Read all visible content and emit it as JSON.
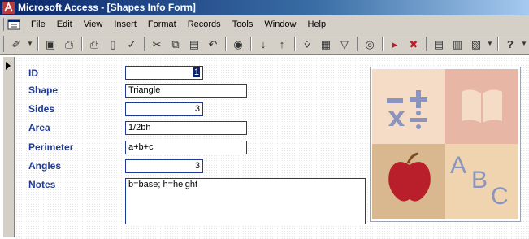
{
  "window": {
    "title": "Microsoft Access - [Shapes Info Form]"
  },
  "menu": [
    {
      "label": "File"
    },
    {
      "label": "Edit"
    },
    {
      "label": "View"
    },
    {
      "label": "Insert"
    },
    {
      "label": "Format"
    },
    {
      "label": "Records"
    },
    {
      "label": "Tools"
    },
    {
      "label": "Window"
    },
    {
      "label": "Help"
    }
  ],
  "toolbar": [
    {
      "icon": "design-view-icon",
      "glyph": "✐"
    },
    {
      "icon": "save-icon",
      "glyph": "▣"
    },
    {
      "icon": "print-preview-icon",
      "glyph": "⎙"
    },
    {
      "icon": "print-icon",
      "glyph": "⎙"
    },
    {
      "icon": "preview-icon",
      "glyph": "▯"
    },
    {
      "icon": "spelling-icon",
      "glyph": "✓"
    },
    {
      "icon": "cut-icon",
      "glyph": "✂"
    },
    {
      "icon": "copy-icon",
      "glyph": "⧉"
    },
    {
      "icon": "paste-icon",
      "glyph": "▤"
    },
    {
      "icon": "undo-icon",
      "glyph": "↶"
    },
    {
      "icon": "insert-hyperlink-icon",
      "glyph": "◉"
    },
    {
      "icon": "sort-ascending-icon",
      "glyph": "↓"
    },
    {
      "icon": "sort-descending-icon",
      "glyph": "↑"
    },
    {
      "icon": "filter-by-selection-icon",
      "glyph": "⩒"
    },
    {
      "icon": "filter-by-form-icon",
      "glyph": "▦"
    },
    {
      "icon": "apply-filter-icon",
      "glyph": "▽"
    },
    {
      "icon": "find-icon",
      "glyph": "◎"
    },
    {
      "icon": "new-record-icon",
      "glyph": "▸"
    },
    {
      "icon": "delete-record-icon",
      "glyph": "✖"
    },
    {
      "icon": "properties-icon",
      "glyph": "▤"
    },
    {
      "icon": "database-window-icon",
      "glyph": "▥"
    },
    {
      "icon": "new-object-icon",
      "glyph": "▧"
    },
    {
      "icon": "help-icon",
      "glyph": "?"
    }
  ],
  "form": {
    "fields": [
      {
        "name": "id",
        "label": "ID",
        "value": "1"
      },
      {
        "name": "shape",
        "label": "Shape",
        "value": "Triangle"
      },
      {
        "name": "sides",
        "label": "Sides",
        "value": "3"
      },
      {
        "name": "area",
        "label": "Area",
        "value": "1/2bh"
      },
      {
        "name": "perimeter",
        "label": "Perimeter",
        "value": "a+b+c"
      },
      {
        "name": "angles",
        "label": "Angles",
        "value": "3"
      },
      {
        "name": "notes",
        "label": "Notes",
        "value": "b=base; h=height"
      }
    ],
    "image": {
      "name": "school-subjects-image",
      "tiles": [
        {
          "icon": "math-symbols-icon",
          "color": "#f5dcc6"
        },
        {
          "icon": "book-icon",
          "color": "#e8b6a4"
        },
        {
          "icon": "apple-icon",
          "color": "#d9b890"
        },
        {
          "icon": "abc-letters-icon",
          "color": "#f0d4b0",
          "text": "ABC"
        }
      ]
    }
  },
  "colors": {
    "label_text": "#1f3a93",
    "field_border": "#1f3a93",
    "titlebar_start": "#0a246a",
    "icon_purple": "#8a94bf",
    "apple_red": "#b81f2a"
  }
}
